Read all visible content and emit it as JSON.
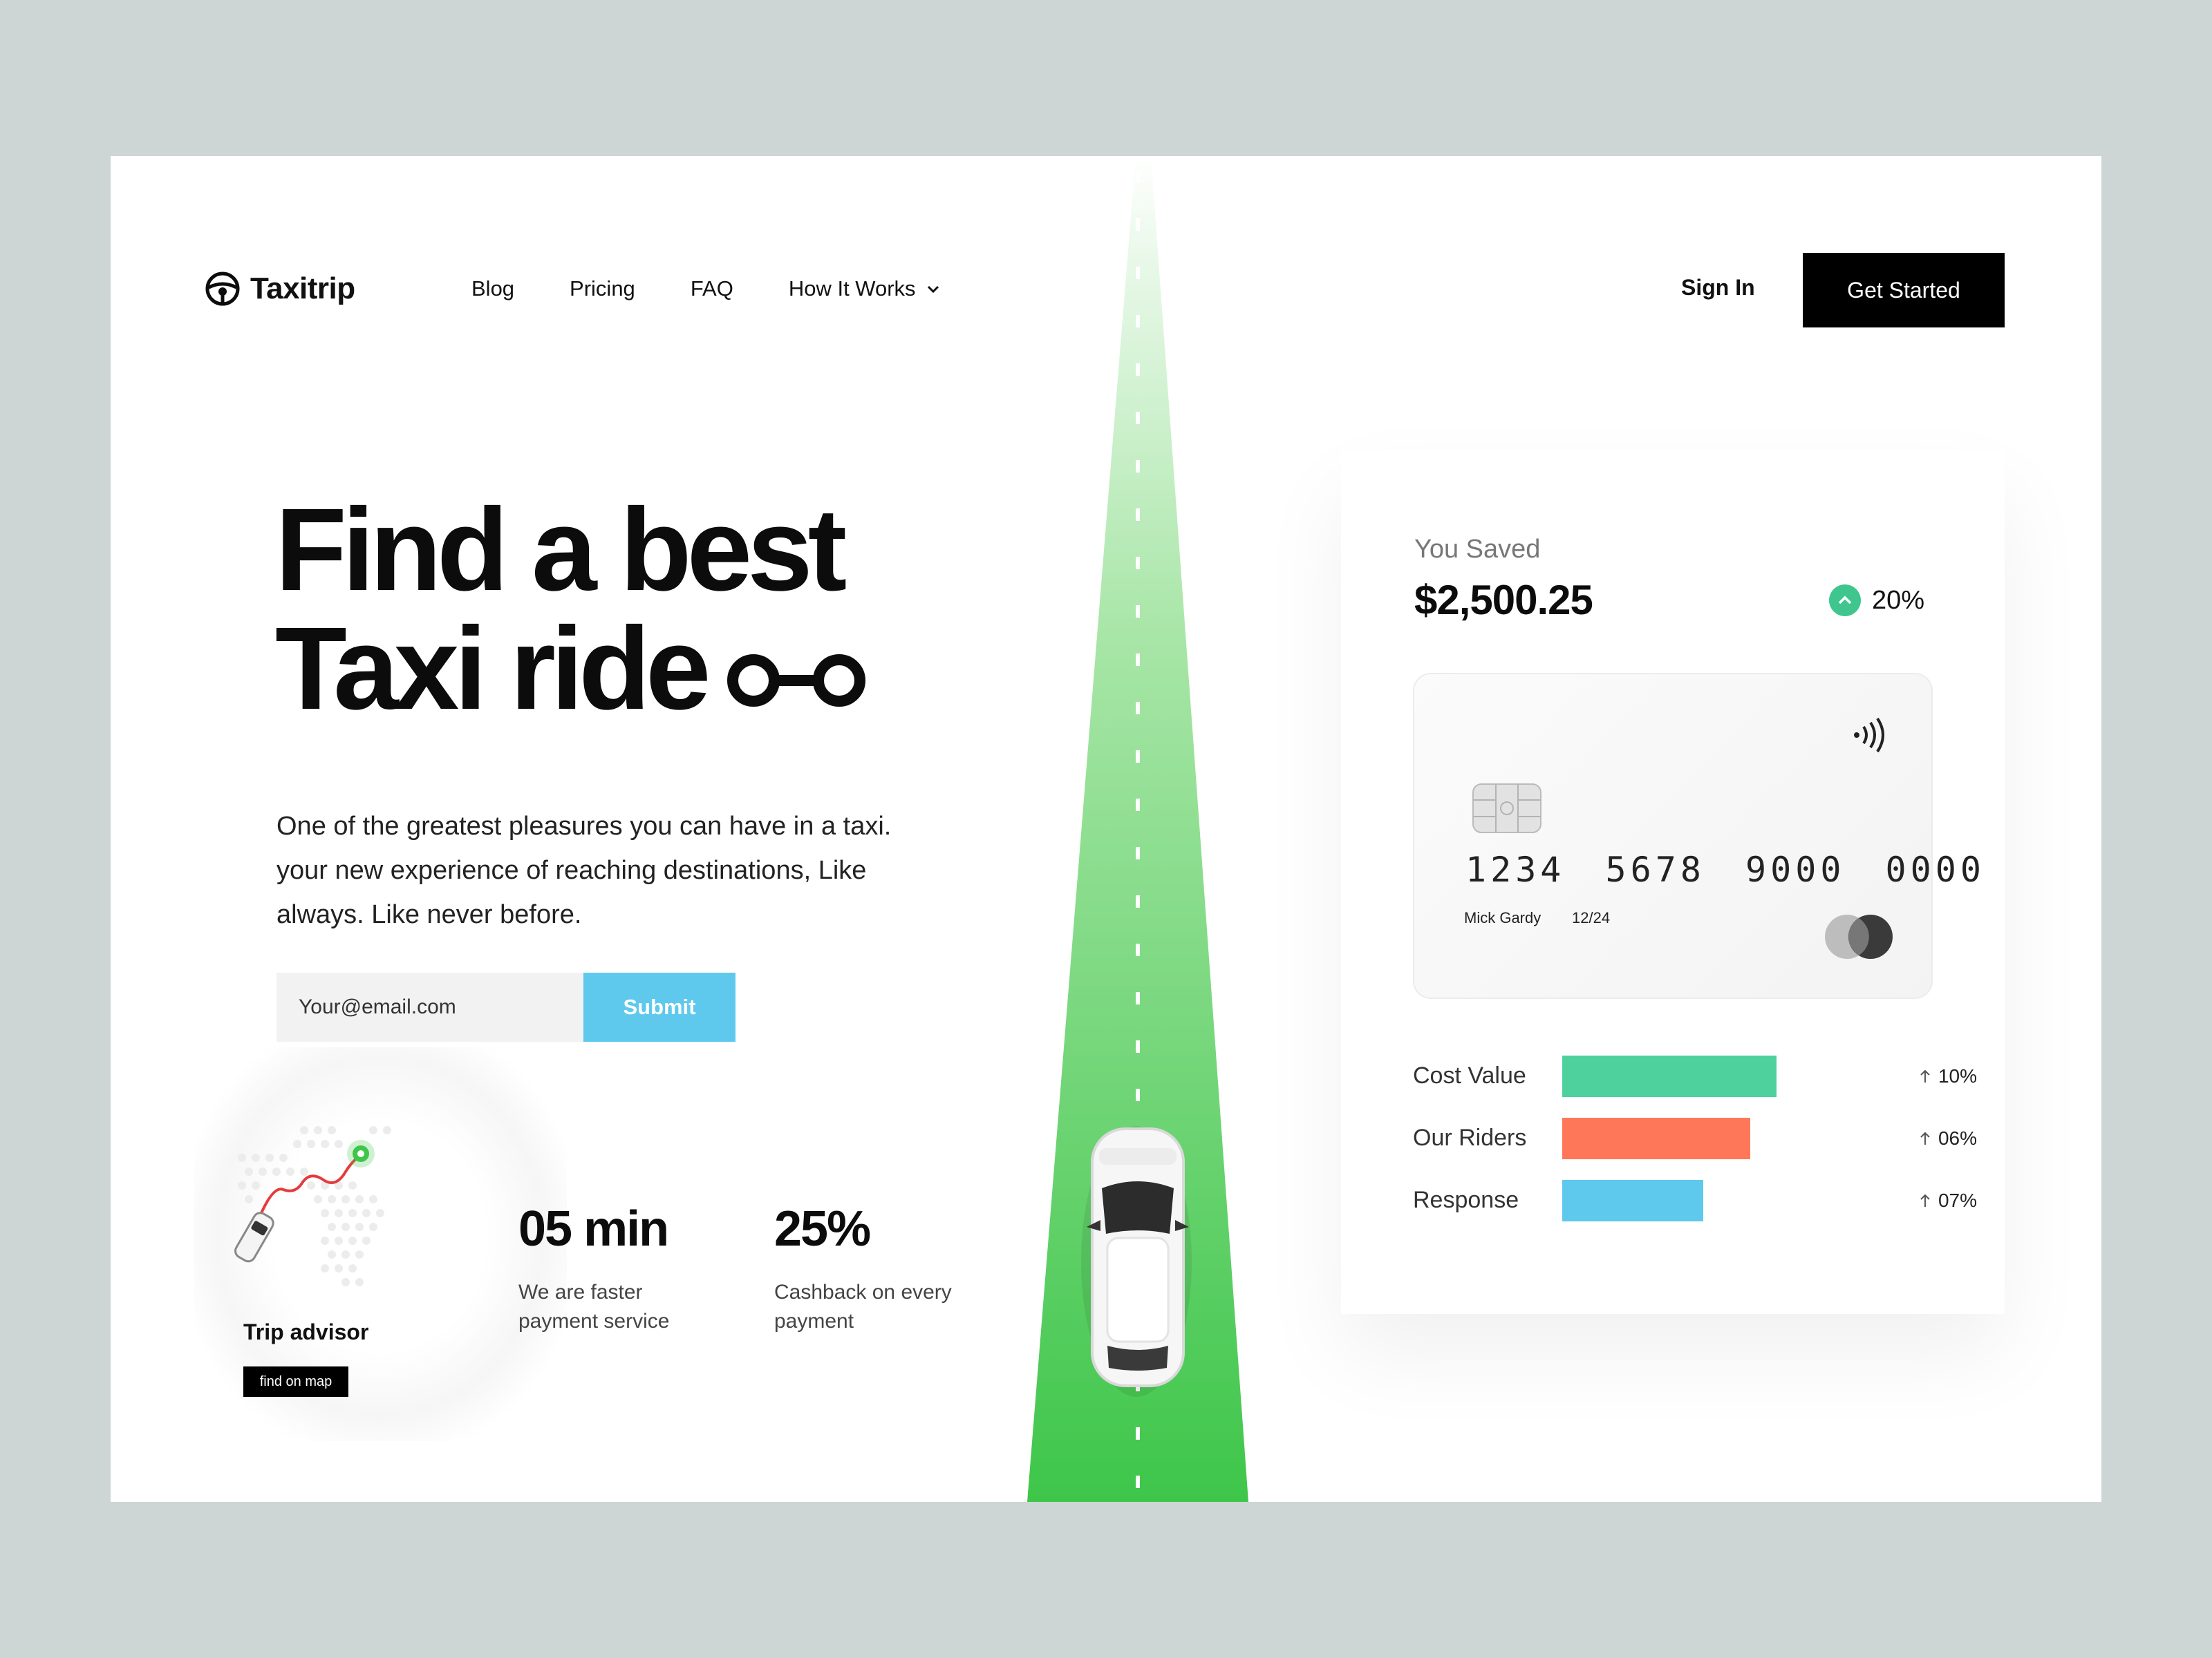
{
  "brand": {
    "name": "Taxitrip",
    "icon": "steering-wheel-icon"
  },
  "nav": {
    "items": [
      {
        "label": "Blog"
      },
      {
        "label": "Pricing"
      },
      {
        "label": "FAQ"
      },
      {
        "label": "How It Works",
        "icon": "chevron-down-icon"
      }
    ],
    "sign_in": "Sign In",
    "get_started": "Get Started"
  },
  "hero": {
    "headline_line1": "Find a best",
    "headline_line2": "Taxi ride",
    "description": "One of the greatest pleasures you can have in a taxi. your new experience of reaching destinations, Like always. Like never before.",
    "email_placeholder": "Your@email.com",
    "submit": "Submit"
  },
  "trip_advisor": {
    "title": "Trip advisor",
    "button": "find on map"
  },
  "stats": [
    {
      "value": "05 min",
      "label": "We are faster payment service"
    },
    {
      "value": "25%",
      "label": "Cashback on every payment"
    }
  ],
  "savings": {
    "label": "You Saved",
    "amount": "$2,500.25",
    "change": "20%",
    "card": {
      "number": "1234 5678 9000 0000",
      "holder": "Mick Gardy",
      "expiry": "12/24"
    },
    "metrics": [
      {
        "label": "Cost Value",
        "percent": "10%",
        "fill": 0.82,
        "color": "#4ed19d"
      },
      {
        "label": "Our Riders",
        "percent": "06%",
        "fill": 0.72,
        "color": "#ff7759"
      },
      {
        "label": "Response",
        "percent": "07%",
        "fill": 0.54,
        "color": "#5ec9ec"
      }
    ]
  },
  "colors": {
    "accent_green": "#3ec64a",
    "submit_blue": "#5ec9ec",
    "dark": "#000000"
  }
}
